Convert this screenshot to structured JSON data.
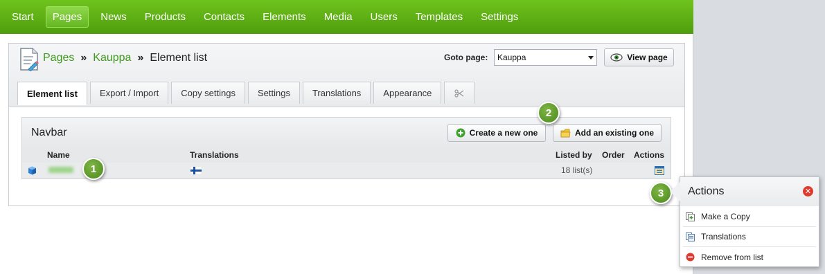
{
  "topnav": {
    "items": [
      "Start",
      "Pages",
      "News",
      "Products",
      "Contacts",
      "Elements",
      "Media",
      "Users",
      "Templates",
      "Settings"
    ],
    "active": "Pages"
  },
  "breadcrumb": {
    "pages": "Pages",
    "sep1": "»",
    "kauppa": "Kauppa",
    "sep2": "»",
    "current": "Element list"
  },
  "goto": {
    "label": "Goto page:",
    "selected": "Kauppa",
    "button": "View page"
  },
  "tabs": [
    "Element list",
    "Export / Import",
    "Copy settings",
    "Settings",
    "Translations",
    "Appearance"
  ],
  "list": {
    "title": "Navbar",
    "create_btn": "Create a new one",
    "add_existing_btn": "Add an existing one",
    "columns": {
      "name": "Name",
      "translations": "Translations",
      "listed_by": "Listed by",
      "order": "Order",
      "actions": "Actions"
    },
    "rows": [
      {
        "listed_by": "18 list(s)"
      }
    ]
  },
  "callouts": [
    "1",
    "2",
    "3"
  ],
  "actions_popup": {
    "title": "Actions",
    "items": [
      "Make a Copy",
      "Translations",
      "Remove from list"
    ]
  },
  "colors": {
    "nav_green": "#5cb017",
    "link_green": "#3e9a1c",
    "callout_green": "#5e9e2c"
  }
}
